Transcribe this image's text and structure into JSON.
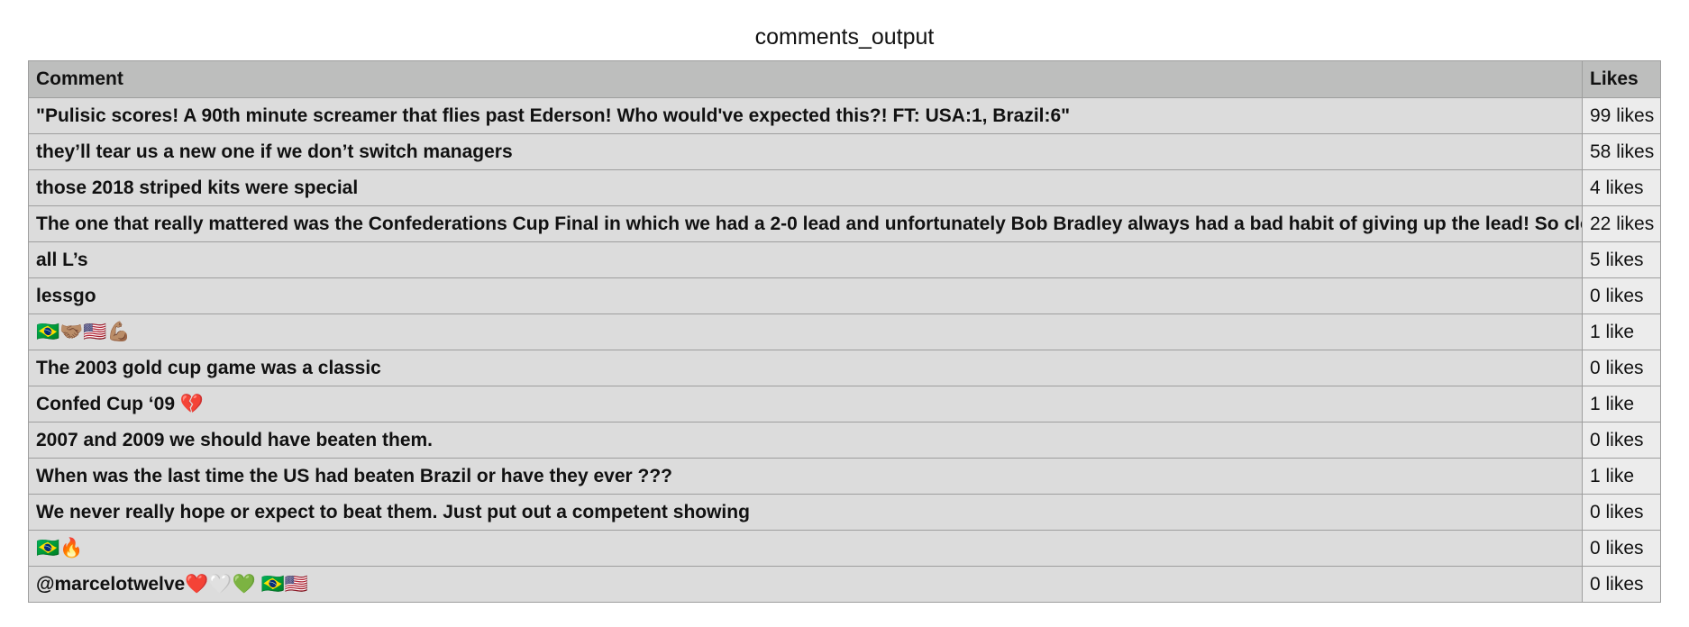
{
  "page_title": "comments_output",
  "table": {
    "headers": {
      "comment": "Comment",
      "likes": "Likes"
    },
    "rows": [
      {
        "comment": "\"Pulisic scores! A 90th minute screamer that flies past Ederson! Who would've expected this?! FT: USA:1, Brazil:6\"",
        "likes": "99 likes"
      },
      {
        "comment": "they’ll tear us a new one if we don’t switch managers",
        "likes": "58 likes"
      },
      {
        "comment": "those 2018 striped kits were special",
        "likes": "4 likes"
      },
      {
        "comment": "The one that really mattered was the Confederations Cup Final in which we had a 2-0 lead and unfortunately Bob Bradley always had a bad habit of giving up the lead! So close 😫",
        "likes": "22 likes"
      },
      {
        "comment": "all L’s",
        "likes": "5 likes"
      },
      {
        "comment": "lessgo",
        "likes": "0 likes"
      },
      {
        "comment": "🇧🇷🤝🏽🇺🇸💪🏽",
        "likes": "1 like"
      },
      {
        "comment": "The 2003 gold cup game was a classic",
        "likes": "0 likes"
      },
      {
        "comment": "Confed Cup ‘09 💔",
        "likes": "1 like"
      },
      {
        "comment": "2007 and 2009 we should have beaten them.",
        "likes": "0 likes"
      },
      {
        "comment": "When was the last time the US had beaten Brazil or have they ever ???",
        "likes": "1 like"
      },
      {
        "comment": "We never really hope or expect to beat them. Just put out a competent showing",
        "likes": "0 likes"
      },
      {
        "comment": "🇧🇷🔥",
        "likes": "0 likes"
      },
      {
        "comment": "@marcelotwelve❤️🤍💚 🇧🇷🇺🇸",
        "likes": "0 likes"
      }
    ]
  }
}
